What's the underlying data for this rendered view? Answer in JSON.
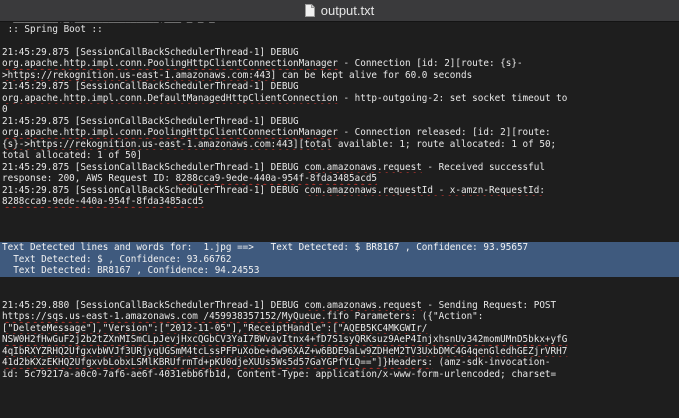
{
  "window": {
    "title": "output.txt"
  },
  "log": [
    {
      "t": "  ________|_|_______________|___/_/_/_/",
      "sel": false
    },
    {
      "t": " :: Spring Boot ::",
      "sel": false
    },
    {
      "t": "",
      "sel": false
    },
    {
      "t": "21:45:29.875 [SessionCallBackSchedulerThread-1] DEBUG",
      "sel": false
    },
    {
      "t": "org.apache.http.impl.conn.PoolingHttpClientConnectionManager - Connection [id: 2][route: {s}-",
      "sel": false,
      "sq": "org.apache.http.impl.conn.PoolingHttpClientConnectionManager"
    },
    {
      "t": ">https://rekognition.us-east-1.amazonaws.com:443] can be kept alive for 60.0 seconds",
      "sel": false,
      "sq": ">https://rekognition.us-east-1.amazonaws.com:443]"
    },
    {
      "t": "21:45:29.875 [SessionCallBackSchedulerThread-1] DEBUG",
      "sel": false
    },
    {
      "t": "org.apache.http.impl.conn.DefaultManagedHttpClientConnection - http-outgoing-2: set socket timeout to",
      "sel": false,
      "sq": "org.apache.http.impl.conn.DefaultManagedHttpClientConnection"
    },
    {
      "t": "0",
      "sel": false
    },
    {
      "t": "21:45:29.875 [SessionCallBackSchedulerThread-1] DEBUG",
      "sel": false
    },
    {
      "t": "org.apache.http.impl.conn.PoolingHttpClientConnectionManager - Connection released: [id: 2][route:",
      "sel": false,
      "sq": "org.apache.http.impl.conn.PoolingHttpClientConnectionManager"
    },
    {
      "t": "{s}->https://rekognition.us-east-1.amazonaws.com:443][total available: 1; route allocated: 1 of 50;",
      "sel": false,
      "sq": "{s}->https://rekognition.us-east-1.amazonaws.com:443][total"
    },
    {
      "t": "total allocated: 1 of 50]",
      "sel": false
    },
    {
      "t": "21:45:29.875 [SessionCallBackSchedulerThread-1] DEBUG com.amazonaws.request - Received successful",
      "sel": false,
      "sq": "com.amazonaws.request"
    },
    {
      "t": "response: 200, AWS Request ID: 8288cca9-9ede-440a-954f-8fda3485acd5",
      "sel": false,
      "sq": "8288cca9-9ede-440a-954f-8fda3485acd5"
    },
    {
      "t": "21:45:29.875 [SessionCallBackSchedulerThread-1] DEBUG com.amazonaws.requestId - x-amzn-RequestId:",
      "sel": false,
      "sq": "com.amazonaws.requestId - x-amzn-RequestId:"
    },
    {
      "t": "8288cca9-9ede-440a-954f-8fda3485acd5",
      "sel": false,
      "sq": "8288cca9-9ede-440a-954f-8fda3485acd5"
    },
    {
      "t": "",
      "sel": false
    },
    {
      "t": "",
      "sel": false
    },
    {
      "t": "",
      "sel": false
    },
    {
      "t": "Text Detected lines and words for:  1.jpg ==>   Text Detected: $ BR8167 , Confidence: 93.95657",
      "sel": true
    },
    {
      "t": "  Text Detected: $ , Confidence: 93.66762",
      "sel": true
    },
    {
      "t": "  Text Detected: BR8167 , Confidence: 94.24553",
      "sel": true
    },
    {
      "t": "",
      "sel": false
    },
    {
      "t": "",
      "sel": false
    },
    {
      "t": "21:45:29.880 [SessionCallBackSchedulerThread-1] DEBUG com.amazonaws.request - Sending Request: POST",
      "sel": false,
      "sq": "com.amazonaws.request"
    },
    {
      "t": "https://sqs.us-east-1.amazonaws.com /459938357152/MyQueue.fifo Parameters: ({\"Action\":",
      "sel": false,
      "sq": "https://sqs.us-east-1.amazonaws.com /459938357152/MyQueue.fifo"
    },
    {
      "t": "[\"DeleteMessage\"],\"Version\":[\"2012-11-05\"],\"ReceiptHandle\":[\"AQEB5KC4MKGWIr/",
      "sel": false,
      "sq": "[\"DeleteMessage\"],\"Version\":[\"2012-11-05\"],\"ReceiptHandle\":[\"AQEB5KC4MKGWIr/"
    },
    {
      "t": "NSW0H2fHwGuF2j2b2tZXnMISmCLpJevjHxcQGbCV3YaI7BWvavItnx4+fD7S1syQRKsuz9AeP4InjxhsnUv342momUMnD5bkx+yfG",
      "sel": false,
      "sq": "NSW0H2fHwGuF2j2b2tZXnMISmCLpJevjHxcQGbCV3YaI7BWvavItnx4+fD7S1syQRKsuz9AeP4InjxhsnUv342momUMnD5bkx+yfG"
    },
    {
      "t": "4qIbRXYZRHQ2UfgxvbWVJf3URjyqUGSmM4tcLssPFPuXobe+dw96XAZ+w6BDE9aLw9ZDHeM2TV3UxbDMC4G4qenGledhGEZjrVRH7",
      "sel": false,
      "sq": "4qIbRXYZRHQ2UfgxvbWVJf3URjyqUGSmM4tcLssPFPuXobe+dw96XAZ+w6BDE9aLw9ZDHeM2TV3UxbDMC4G4qenGledhGEZjrVRH7"
    },
    {
      "t": "41d2bKXzEKHQ2UfgxvbLobxLSMlKBRUfrmTd+pKU0djeXUUs5Ws5d57GaYGPfYLQ==\"]}Headers: (amz-sdk-invocation-",
      "sel": false,
      "sq": "41d2bKXzEKHQ2UfgxvbLobxLSMlKBRUfrmTd+pKU0djeXUUs5Ws5d57GaYGPfYLQ==\"]}Headers:"
    },
    {
      "t": "id: 5c79217a-a0c0-7af6-ae6f-4031ebb6fb1d, Content-Type: application/x-www-form-urlencoded; charset=",
      "sel": false
    }
  ]
}
